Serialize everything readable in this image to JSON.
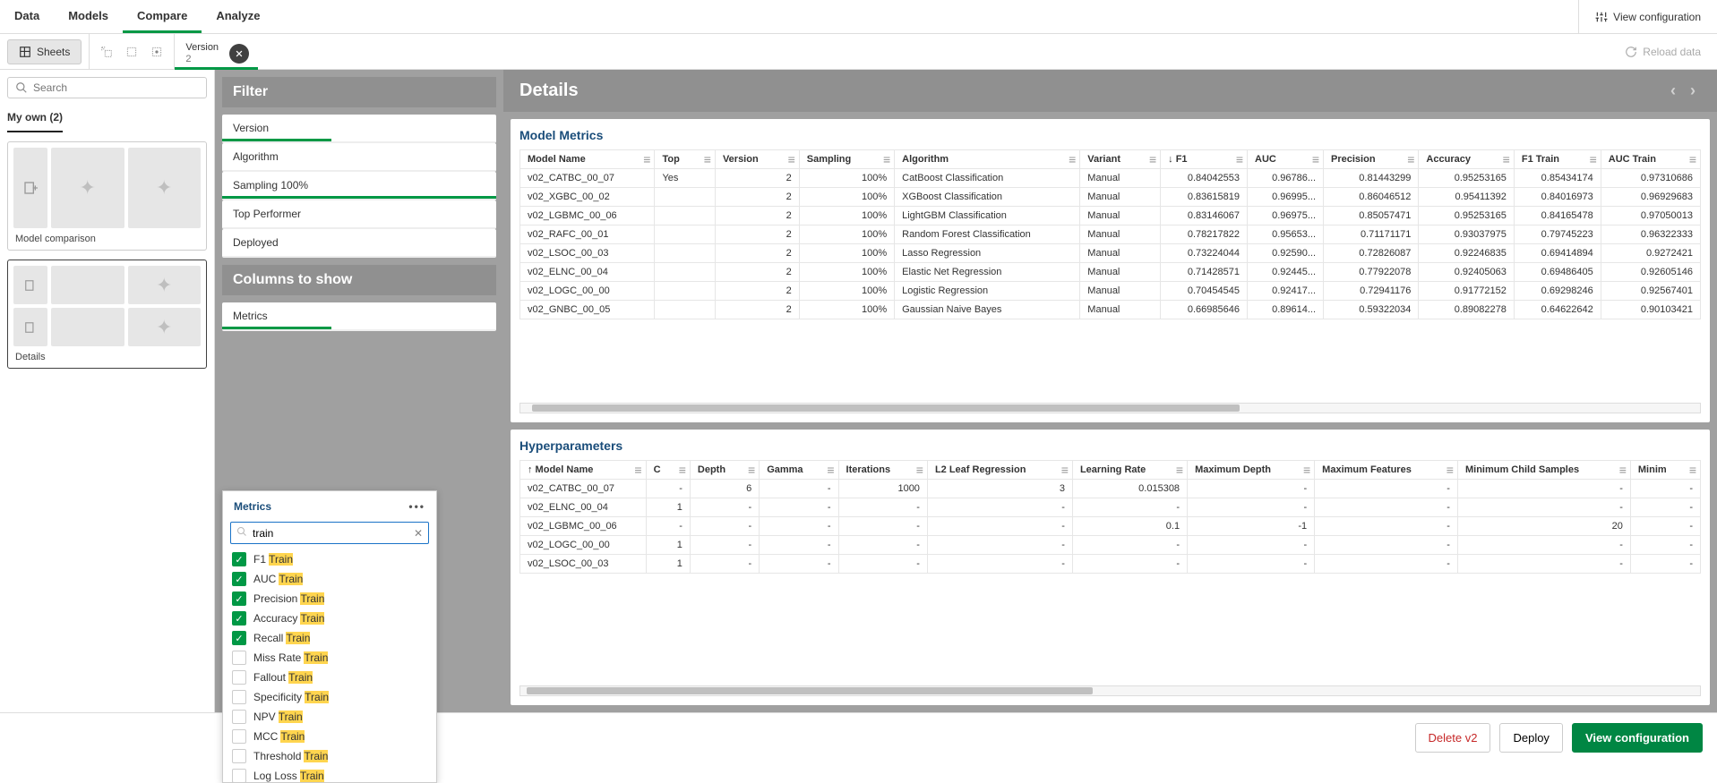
{
  "topnav": {
    "items": [
      "Data",
      "Models",
      "Compare",
      "Analyze"
    ],
    "activeIndex": 2,
    "viewConfig": "View configuration"
  },
  "toolbar": {
    "sheets": "Sheets",
    "tab": {
      "name": "Version",
      "sub": "2"
    },
    "reload": "Reload data"
  },
  "sidebar": {
    "searchPlaceholder": "Search",
    "myOwn": "My own (2)",
    "thumbs": [
      {
        "label": "Model comparison"
      },
      {
        "label": "Details"
      }
    ]
  },
  "filterPanel": {
    "title1": "Filter",
    "title2": "Columns to show",
    "filters": [
      {
        "label": "Version",
        "style": "green"
      },
      {
        "label": "Algorithm",
        "style": ""
      },
      {
        "label": "Sampling 100%",
        "style": "green-full"
      },
      {
        "label": "Top Performer",
        "style": ""
      },
      {
        "label": "Deployed",
        "style": ""
      }
    ],
    "metricsCard": "Metrics",
    "popup": {
      "title": "Metrics",
      "searchValue": "train",
      "items": [
        {
          "pre": "F1 ",
          "hl": "Train",
          "checked": true
        },
        {
          "pre": "AUC ",
          "hl": "Train",
          "checked": true
        },
        {
          "pre": "Precision ",
          "hl": "Train",
          "checked": true
        },
        {
          "pre": "Accuracy ",
          "hl": "Train",
          "checked": true
        },
        {
          "pre": "Recall ",
          "hl": "Train",
          "checked": true
        },
        {
          "pre": "Miss Rate ",
          "hl": "Train",
          "checked": false
        },
        {
          "pre": "Fallout ",
          "hl": "Train",
          "checked": false
        },
        {
          "pre": "Specificity ",
          "hl": "Train",
          "checked": false
        },
        {
          "pre": "NPV ",
          "hl": "Train",
          "checked": false
        },
        {
          "pre": "MCC ",
          "hl": "Train",
          "checked": false
        },
        {
          "pre": "Threshold ",
          "hl": "Train",
          "checked": false
        },
        {
          "pre": "Log Loss ",
          "hl": "Train",
          "checked": false
        }
      ]
    }
  },
  "content": {
    "title": "Details",
    "tables": {
      "metrics": {
        "title": "Model Metrics",
        "cols": [
          "Model Name",
          "Top",
          "Version",
          "Sampling",
          "Algorithm",
          "Variant",
          "F1",
          "AUC",
          "Precision",
          "Accuracy",
          "F1 Train",
          "AUC Train"
        ],
        "sortCol": "F1",
        "rows": [
          [
            "v02_CATBC_00_07",
            "Yes",
            "2",
            "100%",
            "CatBoost Classification",
            "Manual",
            "0.84042553",
            "0.96786...",
            "0.81443299",
            "0.95253165",
            "0.85434174",
            "0.97310686"
          ],
          [
            "v02_XGBC_00_02",
            "",
            "2",
            "100%",
            "XGBoost Classification",
            "Manual",
            "0.83615819",
            "0.96995...",
            "0.86046512",
            "0.95411392",
            "0.84016973",
            "0.96929683"
          ],
          [
            "v02_LGBMC_00_06",
            "",
            "2",
            "100%",
            "LightGBM Classification",
            "Manual",
            "0.83146067",
            "0.96975...",
            "0.85057471",
            "0.95253165",
            "0.84165478",
            "0.97050013"
          ],
          [
            "v02_RAFC_00_01",
            "",
            "2",
            "100%",
            "Random Forest Classification",
            "Manual",
            "0.78217822",
            "0.95653...",
            "0.71171171",
            "0.93037975",
            "0.79745223",
            "0.96322333"
          ],
          [
            "v02_LSOC_00_03",
            "",
            "2",
            "100%",
            "Lasso Regression",
            "Manual",
            "0.73224044",
            "0.92590...",
            "0.72826087",
            "0.92246835",
            "0.69414894",
            "0.9272421"
          ],
          [
            "v02_ELNC_00_04",
            "",
            "2",
            "100%",
            "Elastic Net Regression",
            "Manual",
            "0.71428571",
            "0.92445...",
            "0.77922078",
            "0.92405063",
            "0.69486405",
            "0.92605146"
          ],
          [
            "v02_LOGC_00_00",
            "",
            "2",
            "100%",
            "Logistic Regression",
            "Manual",
            "0.70454545",
            "0.92417...",
            "0.72941176",
            "0.91772152",
            "0.69298246",
            "0.92567401"
          ],
          [
            "v02_GNBC_00_05",
            "",
            "2",
            "100%",
            "Gaussian Naive Bayes",
            "Manual",
            "0.66985646",
            "0.89614...",
            "0.59322034",
            "0.89082278",
            "0.64622642",
            "0.90103421"
          ]
        ]
      },
      "hyper": {
        "title": "Hyperparameters",
        "cols": [
          "Model Name",
          "C",
          "Depth",
          "Gamma",
          "Iterations",
          "L2 Leaf Regression",
          "Learning Rate",
          "Maximum Depth",
          "Maximum Features",
          "Minimum Child Samples",
          "Minim"
        ],
        "sortAscCol": "Model Name",
        "rows": [
          [
            "v02_CATBC_00_07",
            "-",
            "6",
            "-",
            "1000",
            "3",
            "0.015308",
            "-",
            "-",
            "-",
            "-"
          ],
          [
            "v02_ELNC_00_04",
            "1",
            "-",
            "-",
            "-",
            "-",
            "-",
            "-",
            "-",
            "-",
            "-"
          ],
          [
            "v02_LGBMC_00_06",
            "-",
            "-",
            "-",
            "-",
            "-",
            "0.1",
            "-1",
            "-",
            "20",
            "-"
          ],
          [
            "v02_LOGC_00_00",
            "1",
            "-",
            "-",
            "-",
            "-",
            "-",
            "-",
            "-",
            "-",
            "-"
          ],
          [
            "v02_LSOC_00_03",
            "1",
            "-",
            "-",
            "-",
            "-",
            "-",
            "-",
            "-",
            "-",
            "-"
          ]
        ]
      }
    }
  },
  "bottom": {
    "delete": "Delete v2",
    "deploy": "Deploy",
    "viewConfig": "View configuration"
  }
}
